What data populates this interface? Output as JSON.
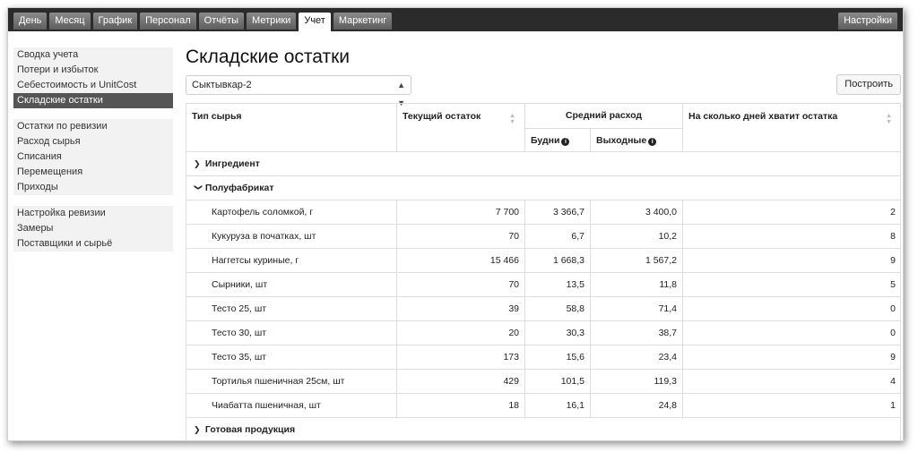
{
  "nav": {
    "tabs": [
      "День",
      "Месяц",
      "График",
      "Персонал",
      "Отчёты",
      "Метрики",
      "Учет",
      "Маркетинг"
    ],
    "active_tab": "Учет",
    "settings": "Настройки"
  },
  "sidebar": {
    "groups": [
      [
        "Сводка учета",
        "Потери и избыток",
        "Себестоимость и UnitCost",
        "Складские остатки"
      ],
      [
        "Остатки по ревизии",
        "Расход сырья",
        "Списания",
        "Перемещения",
        "Приходы"
      ],
      [
        "Настройка ревизии",
        "Замеры",
        "Поставщики и сырьё"
      ]
    ],
    "active_item": "Складские остатки"
  },
  "main": {
    "title": "Складские остатки",
    "location_select": "Сыктывкар-2",
    "build_button": "Построить"
  },
  "table": {
    "headers": {
      "type": "Тип сырья",
      "stock": "Текущий остаток",
      "avg": "Средний расход",
      "weekdays": "Будни",
      "weekends": "Выходные",
      "days": "На сколько дней хватит остатка"
    },
    "groups": {
      "ingredient": "Ингредиент",
      "semi": "Полуфабрикат",
      "ready": "Готовая продукция"
    },
    "rows": [
      {
        "name": "Картофель соломкой, г",
        "stock": "7 700",
        "weekdays": "3 366,7",
        "weekends": "3 400,0",
        "days": "2"
      },
      {
        "name": "Кукуруза в початках, шт",
        "stock": "70",
        "weekdays": "6,7",
        "weekends": "10,2",
        "days": "8"
      },
      {
        "name": "Наггетсы куриные, г",
        "stock": "15 466",
        "weekdays": "1 668,3",
        "weekends": "1 567,2",
        "days": "9"
      },
      {
        "name": "Сырники, шт",
        "stock": "70",
        "weekdays": "13,5",
        "weekends": "11,8",
        "days": "5"
      },
      {
        "name": "Тесто 25, шт",
        "stock": "39",
        "weekdays": "58,8",
        "weekends": "71,4",
        "days": "0"
      },
      {
        "name": "Тесто 30, шт",
        "stock": "20",
        "weekdays": "30,3",
        "weekends": "38,7",
        "days": "0"
      },
      {
        "name": "Тесто 35, шт",
        "stock": "173",
        "weekdays": "15,6",
        "weekends": "23,4",
        "days": "9"
      },
      {
        "name": "Тортилья пшеничная 25см, шт",
        "stock": "429",
        "weekdays": "101,5",
        "weekends": "119,3",
        "days": "4"
      },
      {
        "name": "Чиабатта пшеничная, шт",
        "stock": "18",
        "weekdays": "16,1",
        "weekends": "24,8",
        "days": "1"
      }
    ]
  }
}
